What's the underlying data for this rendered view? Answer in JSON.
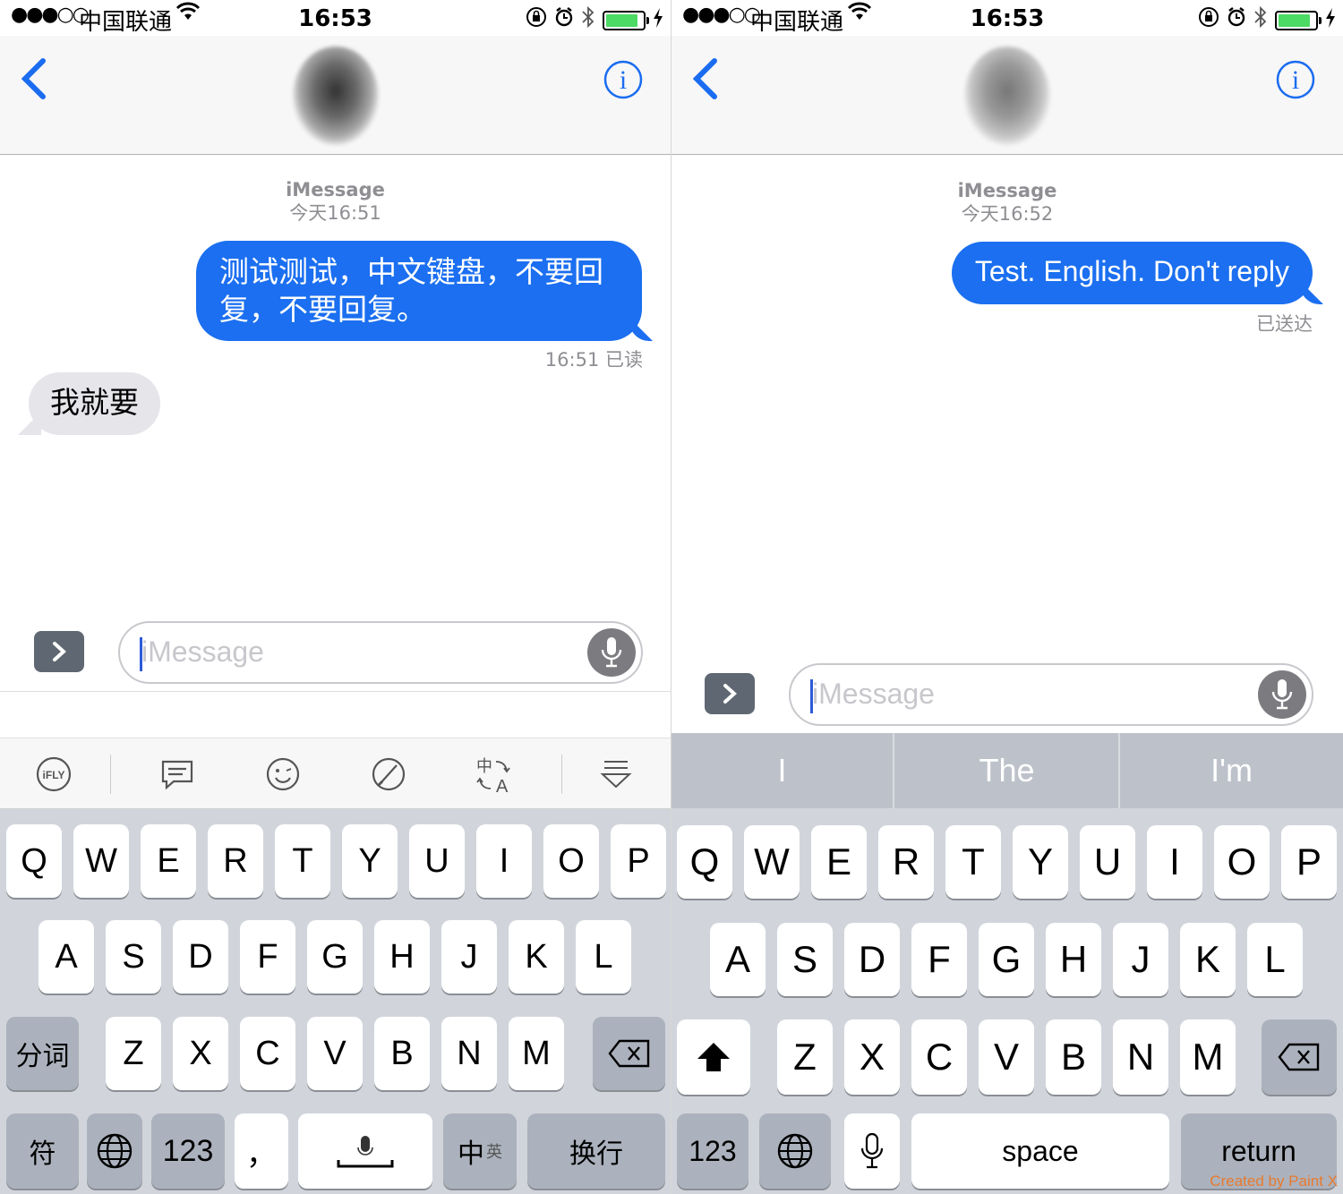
{
  "left": {
    "status": {
      "signal": "●●●○○",
      "carrier": "中国联通",
      "time": "16:53"
    },
    "header": {
      "info_label": "i"
    },
    "meta": {
      "service": "iMessage",
      "timestamp": "今天16:51"
    },
    "messages": [
      {
        "direction": "outgoing",
        "text": "测试测试，中文键盘，不要回复，不要回复。"
      },
      {
        "direction": "incoming",
        "text": "我就要"
      }
    ],
    "receipt": "16:51 已读",
    "input": {
      "placeholder": "iMessage"
    },
    "toolbar": [
      "ifly-icon",
      "message-icon",
      "emoji-icon",
      "handwrite-icon",
      "translate-icon",
      "hide-keyboard-icon"
    ],
    "keyboard": {
      "row1": [
        "Q",
        "W",
        "E",
        "R",
        "T",
        "Y",
        "U",
        "I",
        "O",
        "P"
      ],
      "row2": [
        "A",
        "S",
        "D",
        "F",
        "G",
        "H",
        "J",
        "K",
        "L"
      ],
      "row3": [
        "Z",
        "X",
        "C",
        "V",
        "B",
        "N",
        "M"
      ],
      "split": "分词",
      "symbol": "符",
      "numbers": "123",
      "comma": "，",
      "lang_zh": "中",
      "lang_en": "英",
      "newline": "换行",
      "ifly": "iFLY",
      "translate_zh": "中",
      "translate_a": "A"
    }
  },
  "right": {
    "status": {
      "signal": "●●●○○",
      "carrier": "中国联通",
      "time": "16:53"
    },
    "header": {
      "info_label": "i"
    },
    "meta": {
      "service": "iMessage",
      "timestamp": "今天16:52"
    },
    "messages": [
      {
        "direction": "outgoing",
        "text": "Test. English. Don't reply"
      }
    ],
    "receipt": "已送达",
    "input": {
      "placeholder": "iMessage"
    },
    "suggestions": [
      "I",
      "The",
      "I'm"
    ],
    "keyboard": {
      "row1": [
        "Q",
        "W",
        "E",
        "R",
        "T",
        "Y",
        "U",
        "I",
        "O",
        "P"
      ],
      "row2": [
        "A",
        "S",
        "D",
        "F",
        "G",
        "H",
        "J",
        "K",
        "L"
      ],
      "row3": [
        "Z",
        "X",
        "C",
        "V",
        "B",
        "N",
        "M"
      ],
      "numbers": "123",
      "space": "space",
      "return": "return"
    },
    "watermark": "Created by Paint X"
  },
  "colors": {
    "bubble_out": "#1b6ff0",
    "bubble_in": "#e5e5ea",
    "accent": "#1a6cf0",
    "battery": "#4cd964"
  }
}
